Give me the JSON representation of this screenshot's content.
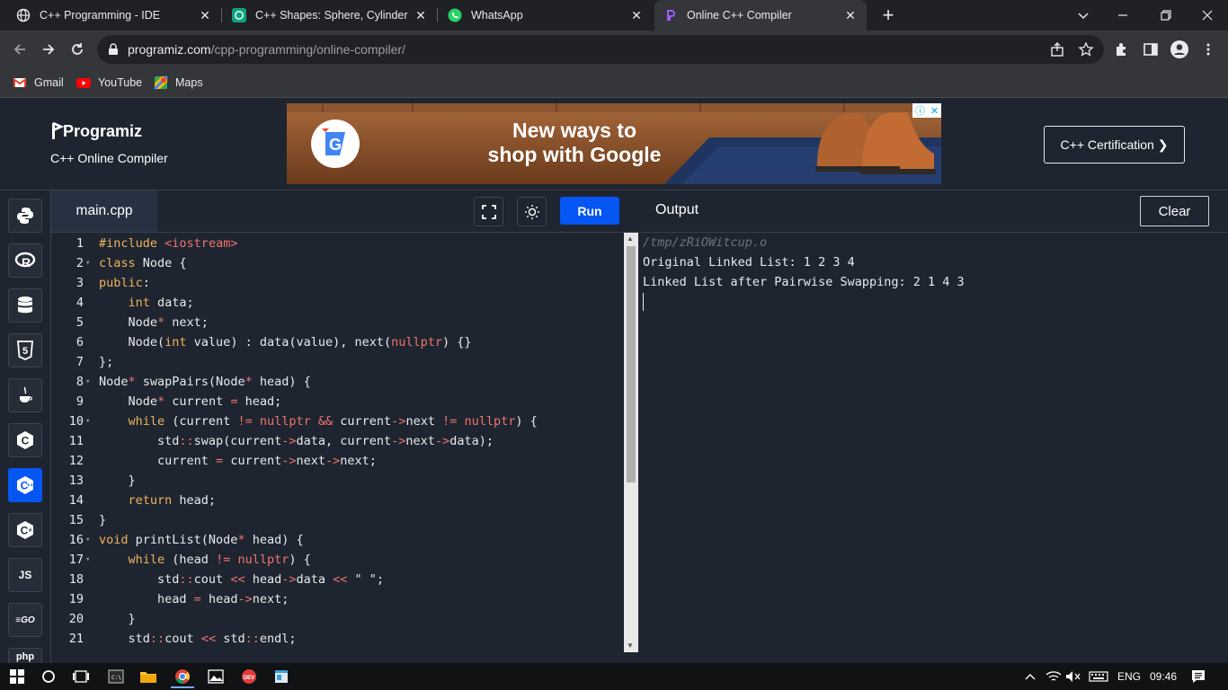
{
  "browser": {
    "tabs": [
      {
        "title": "C++ Programming - IDE",
        "icon": "globe-icon",
        "active": false
      },
      {
        "title": "C++ Shapes: Sphere, Cylinder",
        "icon": "chatgpt-icon",
        "active": false
      },
      {
        "title": "WhatsApp",
        "icon": "whatsapp-icon",
        "active": false
      },
      {
        "title": "Online C++ Compiler",
        "icon": "programiz-icon",
        "active": true
      }
    ],
    "url_host": "programiz.com",
    "url_path": "/cpp-programming/online-compiler/",
    "bookmarks": [
      {
        "label": "Gmail",
        "icon": "gmail-icon"
      },
      {
        "label": "YouTube",
        "icon": "youtube-icon"
      },
      {
        "label": "Maps",
        "icon": "maps-icon"
      }
    ]
  },
  "header": {
    "logo_text": "Programiz",
    "subtitle": "C++ Online Compiler",
    "cert_button": "C++ Certification ❯",
    "ad_text_line1": "New ways to",
    "ad_text_line2": "shop with Google"
  },
  "sidebar": {
    "languages": [
      {
        "name": "python-icon",
        "glyph": ""
      },
      {
        "name": "r-icon",
        "glyph": "R"
      },
      {
        "name": "sql-icon",
        "glyph": ""
      },
      {
        "name": "html-icon",
        "glyph": "5"
      },
      {
        "name": "java-icon",
        "glyph": ""
      },
      {
        "name": "c-icon",
        "glyph": "C"
      },
      {
        "name": "cpp-icon",
        "glyph": "C"
      },
      {
        "name": "csharp-icon",
        "glyph": "C"
      },
      {
        "name": "javascript-icon",
        "glyph": "JS"
      },
      {
        "name": "go-icon",
        "glyph": "GO"
      },
      {
        "name": "php-icon",
        "glyph": "php"
      }
    ],
    "active_index": 6
  },
  "editor": {
    "filename": "main.cpp",
    "run_label": "Run",
    "lines": [
      "#include <iostream>",
      "class Node {",
      "public:",
      "    int data;",
      "    Node* next;",
      "    Node(int value) : data(value), next(nullptr) {}",
      "};",
      "Node* swapPairs(Node* head) {",
      "    Node* current = head;",
      "    while (current != nullptr && current->next != nullptr) {",
      "        std::swap(current->data, current->next->data);",
      "        current = current->next->next;",
      "    }",
      "    return head;",
      "}",
      "void printList(Node* head) {",
      "    while (head != nullptr) {",
      "        std::cout << head->data << \" \";",
      "        head = head->next;",
      "    }",
      "    std::cout << std::endl;"
    ],
    "folded_lines": [
      2,
      8,
      10,
      16,
      17
    ]
  },
  "output": {
    "title": "Output",
    "clear_label": "Clear",
    "path": "/tmp/zRiOWitcup.o",
    "lines": [
      "Original Linked List: 1 2 3 4",
      "Linked List after Pairwise Swapping: 2 1 4 3"
    ]
  },
  "taskbar": {
    "language": "ENG",
    "time": "09:46"
  }
}
